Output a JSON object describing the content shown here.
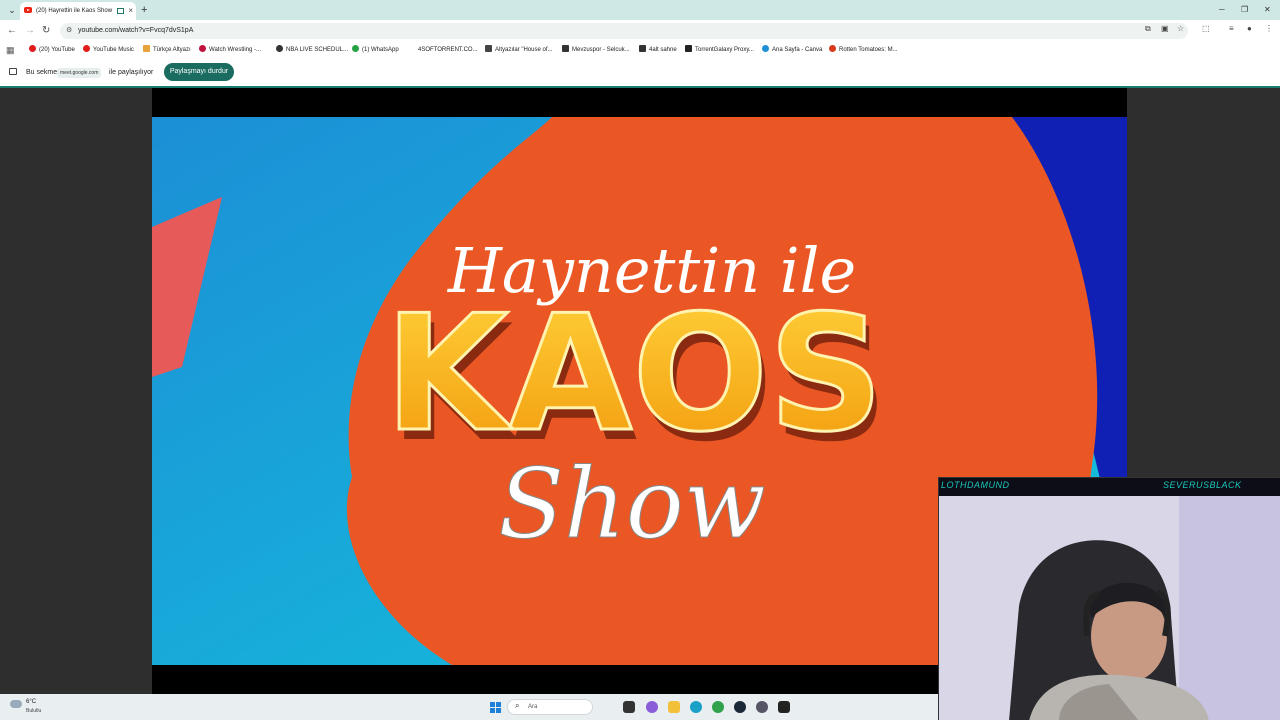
{
  "tab": {
    "title": "(20) Hayrettin ile Kaos Show"
  },
  "address": {
    "url": "youtube.com/watch?v=Fvcq7dvS1pA"
  },
  "bookmarks": [
    {
      "label": "(20) YouTube",
      "color": "#e21b1b"
    },
    {
      "label": "YouTube Music",
      "color": "#e21b1b"
    },
    {
      "label": "Türkçe Altyazı",
      "color": "#e8a23a"
    },
    {
      "label": "Watch Wrestling -...",
      "color": "#c0123c"
    },
    {
      "label": "NBA LIVE SCHEDUL...",
      "color": "#333333"
    },
    {
      "label": "(1) WhatsApp",
      "color": "#25a244"
    },
    {
      "label": "4SOFTORRENT.CO...",
      "color": "#ffffff"
    },
    {
      "label": "Altyazılar \"House of...",
      "color": "#444444"
    },
    {
      "label": "Mevzuspor - Selcuk...",
      "color": "#333333"
    },
    {
      "label": "4alt sahne",
      "color": "#333333"
    },
    {
      "label": "TorrentGalaxy Proxy...",
      "color": "#222222"
    },
    {
      "label": "Ana Sayfa - Canva",
      "color": "#1f8fd6"
    },
    {
      "label": "Rotten Tomatoes: M...",
      "color": "#d83a1c"
    }
  ],
  "sharebar": {
    "prefix": "Bu sekme",
    "domain": "meet.google.com",
    "suffix": "ile paylaşılıyor",
    "stop_label": "Paylaşmayı durdur"
  },
  "video": {
    "title_script": "Haynettin ile",
    "title_main": "KAOS",
    "title_sub": "Show"
  },
  "webcam": {
    "name_left": "LOTHDAMUND",
    "name_right": "SEVERUSBLACK"
  },
  "taskbar": {
    "temperature": "6°C",
    "weather": "Bulutlu",
    "search_placeholder": "Ara"
  },
  "colors": {
    "accent": "#1a6b60",
    "tabstrip": "#cfe8e6"
  }
}
